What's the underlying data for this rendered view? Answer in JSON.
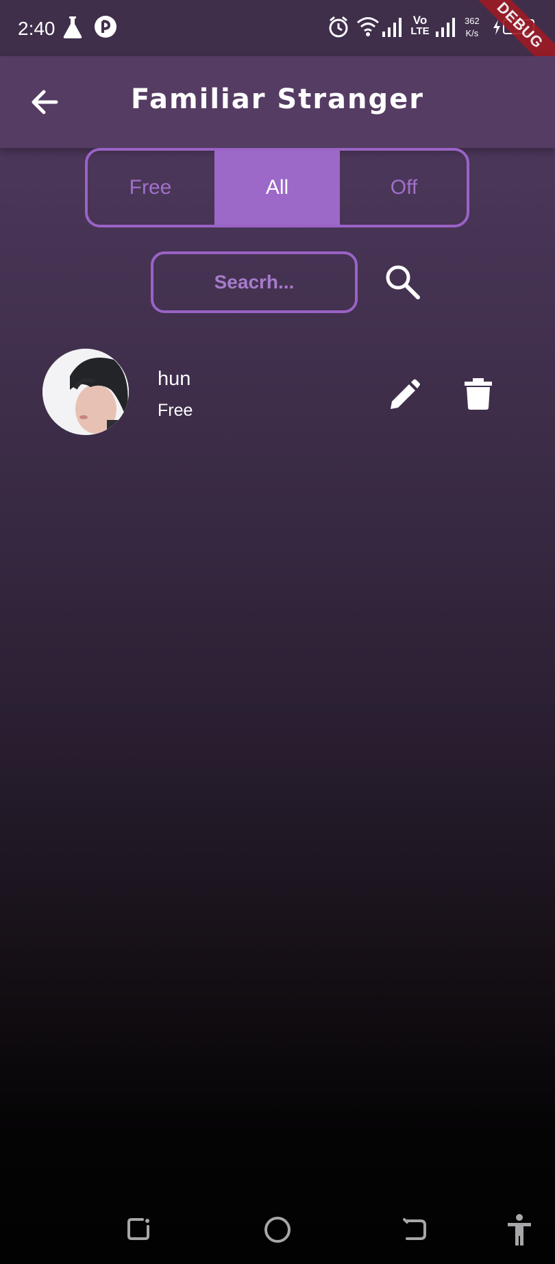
{
  "status_bar": {
    "time": "2:40",
    "network_speed_value": "362",
    "network_speed_unit": "K/s",
    "battery_level": "99",
    "volte_top": "Vo",
    "volte_bottom": "LTE",
    "icons": [
      "flask-icon",
      "app-notification-icon",
      "alarm-icon",
      "wifi-icon",
      "signal-icon",
      "volte-icon",
      "signal-icon",
      "charging-icon",
      "battery-icon"
    ]
  },
  "debug_banner": "DEBUG",
  "app_bar": {
    "title": "Familiar Stranger",
    "back_icon": "arrow-back-icon"
  },
  "filter": {
    "options": [
      "Free",
      "All",
      "Off"
    ],
    "selected": "All",
    "accent": "#9c69c8"
  },
  "search": {
    "placeholder": "Seacrh...",
    "icon": "search-icon"
  },
  "contacts": [
    {
      "name": "hun",
      "status": "Free",
      "avatar": "avatar-photo",
      "actions": [
        "edit-icon",
        "delete-icon"
      ]
    }
  ],
  "nav_bar": {
    "icons": [
      "recents-icon",
      "home-icon",
      "back-icon",
      "accessibility-icon"
    ]
  },
  "colors": {
    "app_bar": "#553c63",
    "status_bar": "#3f2f4b",
    "accent": "#9a63c6",
    "debug": "#9e1b25"
  }
}
